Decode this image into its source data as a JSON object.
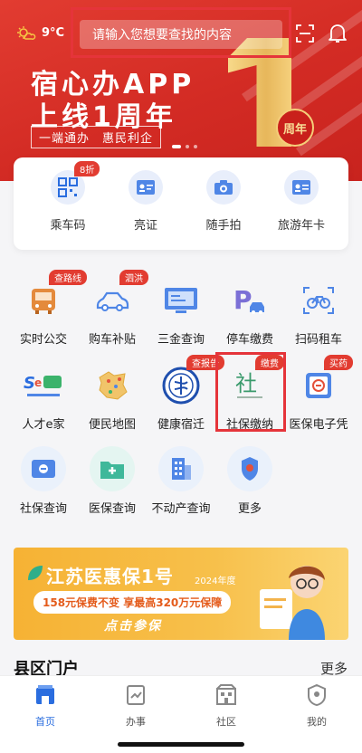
{
  "topbar": {
    "temperature": "9°C",
    "search_placeholder": "请输入您想要查找的内容"
  },
  "banner": {
    "title_line1": "宿心办APP",
    "title_line2": "上线1周年",
    "slogan": "一端通办　惠民利企",
    "year_badge": "周年"
  },
  "quick": {
    "items": [
      {
        "label": "乘车码",
        "badge": "8折"
      },
      {
        "label": "亮证"
      },
      {
        "label": "随手拍"
      },
      {
        "label": "旅游年卡"
      }
    ]
  },
  "services": {
    "row1": [
      {
        "label": "实时公交",
        "badge": "查路线"
      },
      {
        "label": "购车补贴",
        "badge": "泗洪"
      },
      {
        "label": "三金查询"
      },
      {
        "label": "停车缴费"
      },
      {
        "label": "扫码租车"
      }
    ],
    "row2": [
      {
        "label": "人才e家"
      },
      {
        "label": "便民地图"
      },
      {
        "label": "健康宿迁",
        "badge": "查报告"
      },
      {
        "label": "社保缴纳",
        "badge": "缴费"
      },
      {
        "label": "医保电子凭",
        "badge": "买药"
      }
    ],
    "row3": [
      {
        "label": "社保查询"
      },
      {
        "label": "医保查询"
      },
      {
        "label": "不动产查询"
      },
      {
        "label": "更多"
      }
    ]
  },
  "insurance_banner": {
    "title": "江苏医惠保1号",
    "year": "2024年度",
    "subtitle": "158元保费不变 享最高320万元保障",
    "cta": "点击参保"
  },
  "section": {
    "title": "县区门户",
    "more": "更多"
  },
  "tabbar": {
    "items": [
      {
        "label": "首页"
      },
      {
        "label": "办事"
      },
      {
        "label": "社区"
      },
      {
        "label": "我的"
      }
    ]
  },
  "colors": {
    "brand_red": "#e23c31",
    "accent_blue": "#2a6ddf",
    "highlight_red": "#e5343a"
  }
}
